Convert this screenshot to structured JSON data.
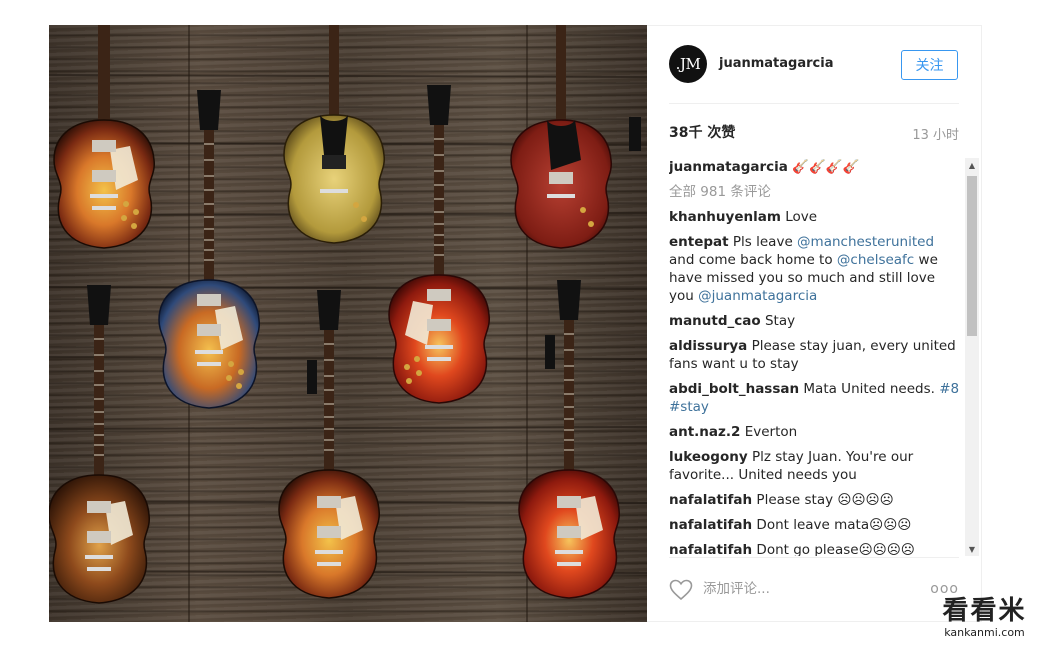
{
  "post": {
    "avatar_text": ".JM",
    "username": "juanmatagarcia",
    "follow_label": "关注",
    "likes": "38千 次赞",
    "time": "13 小时"
  },
  "comments": {
    "caption": {
      "user": "juanmatagarcia",
      "text": "🎸🎸🎸🎸"
    },
    "view_all": "全部 981 条评论",
    "items": [
      {
        "user": "khanhuyenlam",
        "text": "Love"
      },
      {
        "user": "entepat",
        "text_a": "Pls leave ",
        "mention_1": "@manchesterunited",
        "text_b": " and come back home to ",
        "mention_2": "@chelseafc",
        "text_c": " we have missed you so much and still love you ",
        "mention_3": "@juanmatagarcia"
      },
      {
        "user": "manutd_cao",
        "text": "Stay"
      },
      {
        "user": "aldissurya",
        "text": "Please stay juan, every united fans want u to stay"
      },
      {
        "user": "abdi_bolt_hassan",
        "text": "Mata United needs.",
        "tag_1": "#8",
        "tag_2": "#stay"
      },
      {
        "user": "ant.naz.2",
        "text": "Everton"
      },
      {
        "user": "lukeogony",
        "text": "Plz stay Juan. You're our favorite... United needs you"
      },
      {
        "user": "nafalatifah",
        "text": "Please stay ☹☹☹☹"
      },
      {
        "user": "nafalatifah",
        "text": "Dont leave mata☹☹☹"
      },
      {
        "user": "nafalatifah",
        "text": "Dont go please☹☹☹☹"
      }
    ]
  },
  "footer": {
    "placeholder": "添加评论...",
    "more": "ooo"
  },
  "watermark": {
    "big": "看看米",
    "small": "kankanmi.com"
  },
  "icons": {
    "heart": "heart-outline-icon",
    "more": "ellipsis-icon",
    "scroll_up": "triangle-up-icon",
    "scroll_down": "triangle-down-icon"
  }
}
